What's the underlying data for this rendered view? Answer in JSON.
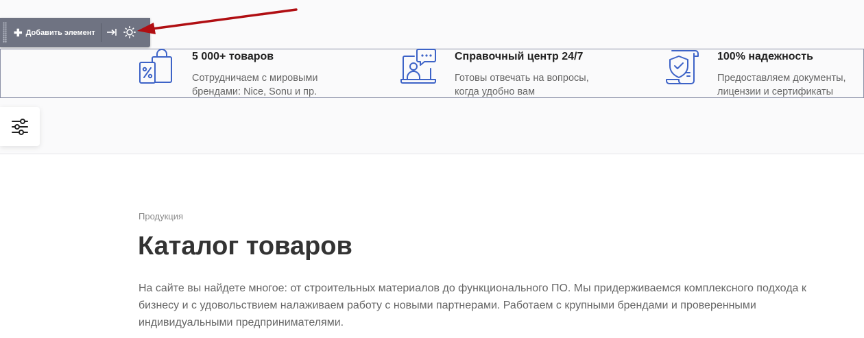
{
  "toolbar": {
    "add_label": "Добавить элемент",
    "add_icon": "plus-icon",
    "pin_icon": "pin-icon",
    "settings_icon": "gear-icon"
  },
  "features": [
    {
      "icon": "shopping-bag-percent-icon",
      "title": "5 000+ товаров",
      "text": "Сотрудничаем с мировыми брендами: Nice, Sonu и пр."
    },
    {
      "icon": "support-center-icon",
      "title": "Справочный центр 24/7",
      "text": "Готовы отвечать на вопросы, когда удобно вам"
    },
    {
      "icon": "shield-document-icon",
      "title": "100% надежность",
      "text": "Предоставляем документы, лицензии и сертификаты"
    }
  ],
  "filter_icon": "filter-sliders-icon",
  "breadcrumb": "Продукция",
  "page_title": "Каталог товаров",
  "intro": "На сайте вы найдете многое: от строительных материалов до функционального ПО. Мы придерживаемся комплексного подхода к бизнесу и с удовольствием налаживаем работу с новыми партнерами. Работаем с крупными брендами и проверенными индивидуальными предпринимателями.",
  "colors": {
    "accent_icon": "#3d63c7",
    "toolbar_bg": "#6f7382",
    "annotation_arrow": "#b00e12"
  }
}
